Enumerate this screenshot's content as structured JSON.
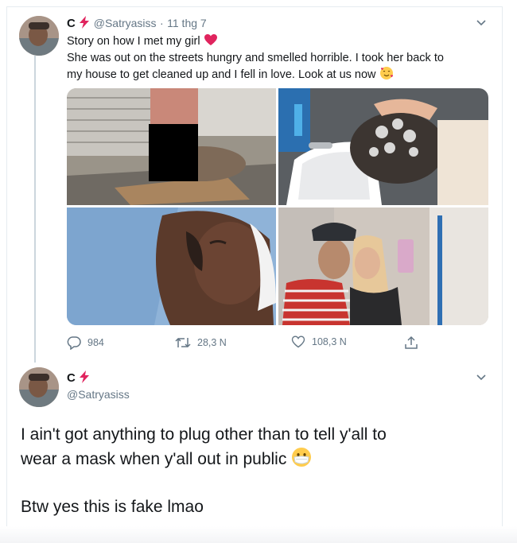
{
  "tweet1": {
    "display_name": "C",
    "handle": "@Satryasiss",
    "separator": "·",
    "date": "11 thg 7",
    "line1": "Story on how I met my girl",
    "line2": "She was out on the streets hungry and smelled horrible. I took her back to",
    "line3": "my house to get cleaned up and I fell in love. Look at us now",
    "heart_emoji": "❤️",
    "face_emoji": "🥰",
    "replies": "984",
    "retweets": "28,3 N",
    "likes": "108,3 N",
    "icons": [
      "reply-icon",
      "retweet-icon",
      "like-icon",
      "share-icon",
      "lightning-icon",
      "chevron-down-icon"
    ]
  },
  "tweet2": {
    "display_name": "C",
    "handle": "@Satryasiss",
    "text_line1": "I ain't got anything to plug other than to tell y'all to",
    "text_line2": "wear a mask when y'all out in public",
    "mask_emoji": "😷",
    "text_line3": "Btw yes this is fake lmao"
  },
  "colors": {
    "lightning": "#e0245e",
    "secondary_text": "#657786",
    "primary_text": "#14171a",
    "thread_line": "#ccd6dd",
    "heart": "#e0245e"
  }
}
